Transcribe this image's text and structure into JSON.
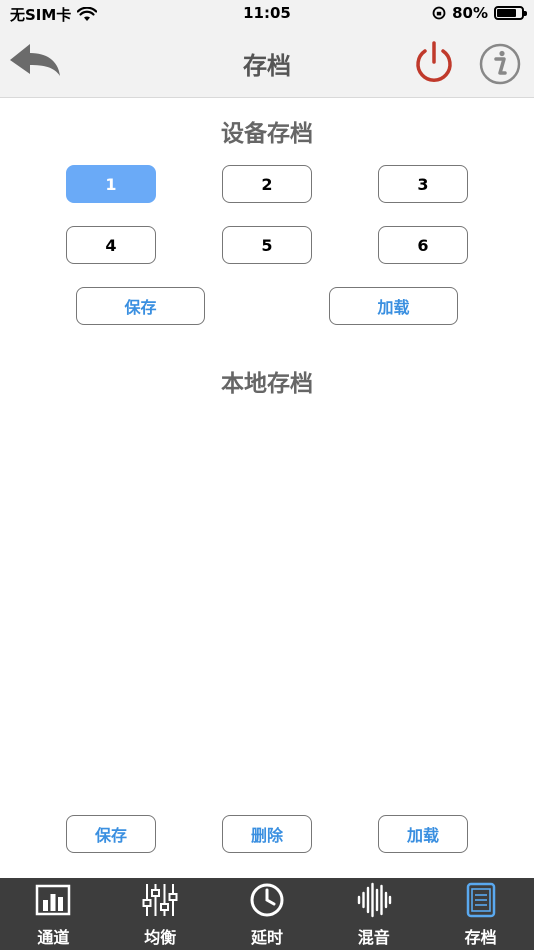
{
  "status": {
    "carrier": "无SIM卡",
    "time": "11:05",
    "battery": "80%",
    "battery_level": 0.8
  },
  "nav": {
    "title": "存档",
    "back_icon": "back-arrow-icon",
    "power_icon": "power-icon",
    "info_icon": "info-icon",
    "power_color": "#c0392b"
  },
  "device_archive": {
    "title": "设备存档",
    "slots": [
      "1",
      "2",
      "3",
      "4",
      "5",
      "6"
    ],
    "selected_slot": "1",
    "save_label": "保存",
    "load_label": "加载"
  },
  "local_archive": {
    "title": "本地存档",
    "save_label": "保存",
    "delete_label": "删除",
    "load_label": "加载"
  },
  "tabs": [
    {
      "label": "通道",
      "icon": "channel-bars-icon"
    },
    {
      "label": "均衡",
      "icon": "equalizer-sliders-icon"
    },
    {
      "label": "延时",
      "icon": "clock-icon"
    },
    {
      "label": "混音",
      "icon": "waveform-icon"
    },
    {
      "label": "存档",
      "icon": "archive-icon",
      "active": true
    }
  ],
  "colors": {
    "accent": "#3a8fe0",
    "selected_slot": "#6aaaf7",
    "tab_bar": "#3d3d3d",
    "tab_active_icon": "#5aa9f0"
  }
}
